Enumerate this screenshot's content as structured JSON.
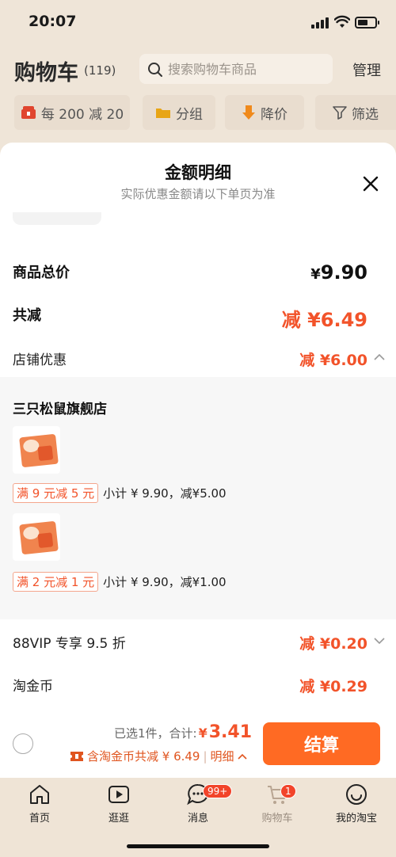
{
  "status_bar": {
    "time": "20:07"
  },
  "cart": {
    "title": "购物车",
    "count": "(119)",
    "search_placeholder": "搜索购物车商品",
    "manage_label": "管理",
    "filters": [
      {
        "label": "每 200 减 20",
        "icon": "coupon-icon"
      },
      {
        "label": "分组",
        "icon": "folder-icon"
      },
      {
        "label": "降价",
        "icon": "price-drop-icon"
      },
      {
        "label": "筛选",
        "icon": "filter-icon"
      }
    ]
  },
  "detail_sheet": {
    "title": "金额明细",
    "subtitle": "实际优惠金额请以下单页为准",
    "total_price": {
      "label": "商品总价",
      "currency": "¥",
      "value": "9.90"
    },
    "total_discount": {
      "label": "共减",
      "value": "减 ¥6.49"
    },
    "shop_discount": {
      "label": "店铺优惠",
      "value": "减 ¥6.00"
    },
    "shop": {
      "name": "三只松鼠旗舰店",
      "items": [
        {
          "promo": "满 9 元减 5 元",
          "summary": "小计 ¥ 9.90，减¥5.00"
        },
        {
          "promo": "满 2 元减 1 元",
          "summary": "小计 ¥ 9.90，减¥1.00"
        }
      ]
    },
    "vip": {
      "label": "88VIP 专享 9.5 折",
      "value": "减 ¥0.20"
    },
    "taojinbi": {
      "label": "淘金币",
      "value": "减 ¥0.29"
    }
  },
  "checkout": {
    "selected_text": "已选1件，合计:",
    "currency": "¥",
    "total": "3.41",
    "coin_text": "含淘金币共减 ¥ 6.49",
    "detail_link": "明细",
    "button_label": "结算"
  },
  "tabbar": {
    "items": [
      {
        "label": "首页",
        "icon": "home-icon"
      },
      {
        "label": "逛逛",
        "icon": "video-play-icon"
      },
      {
        "label": "消息",
        "icon": "message-icon",
        "badge": "99+"
      },
      {
        "label": "购物车",
        "icon": "cart-icon",
        "badge": "1"
      },
      {
        "label": "我的淘宝",
        "icon": "profile-icon"
      }
    ]
  },
  "colors": {
    "accent": "#f2532a",
    "button": "#ff6a23"
  }
}
